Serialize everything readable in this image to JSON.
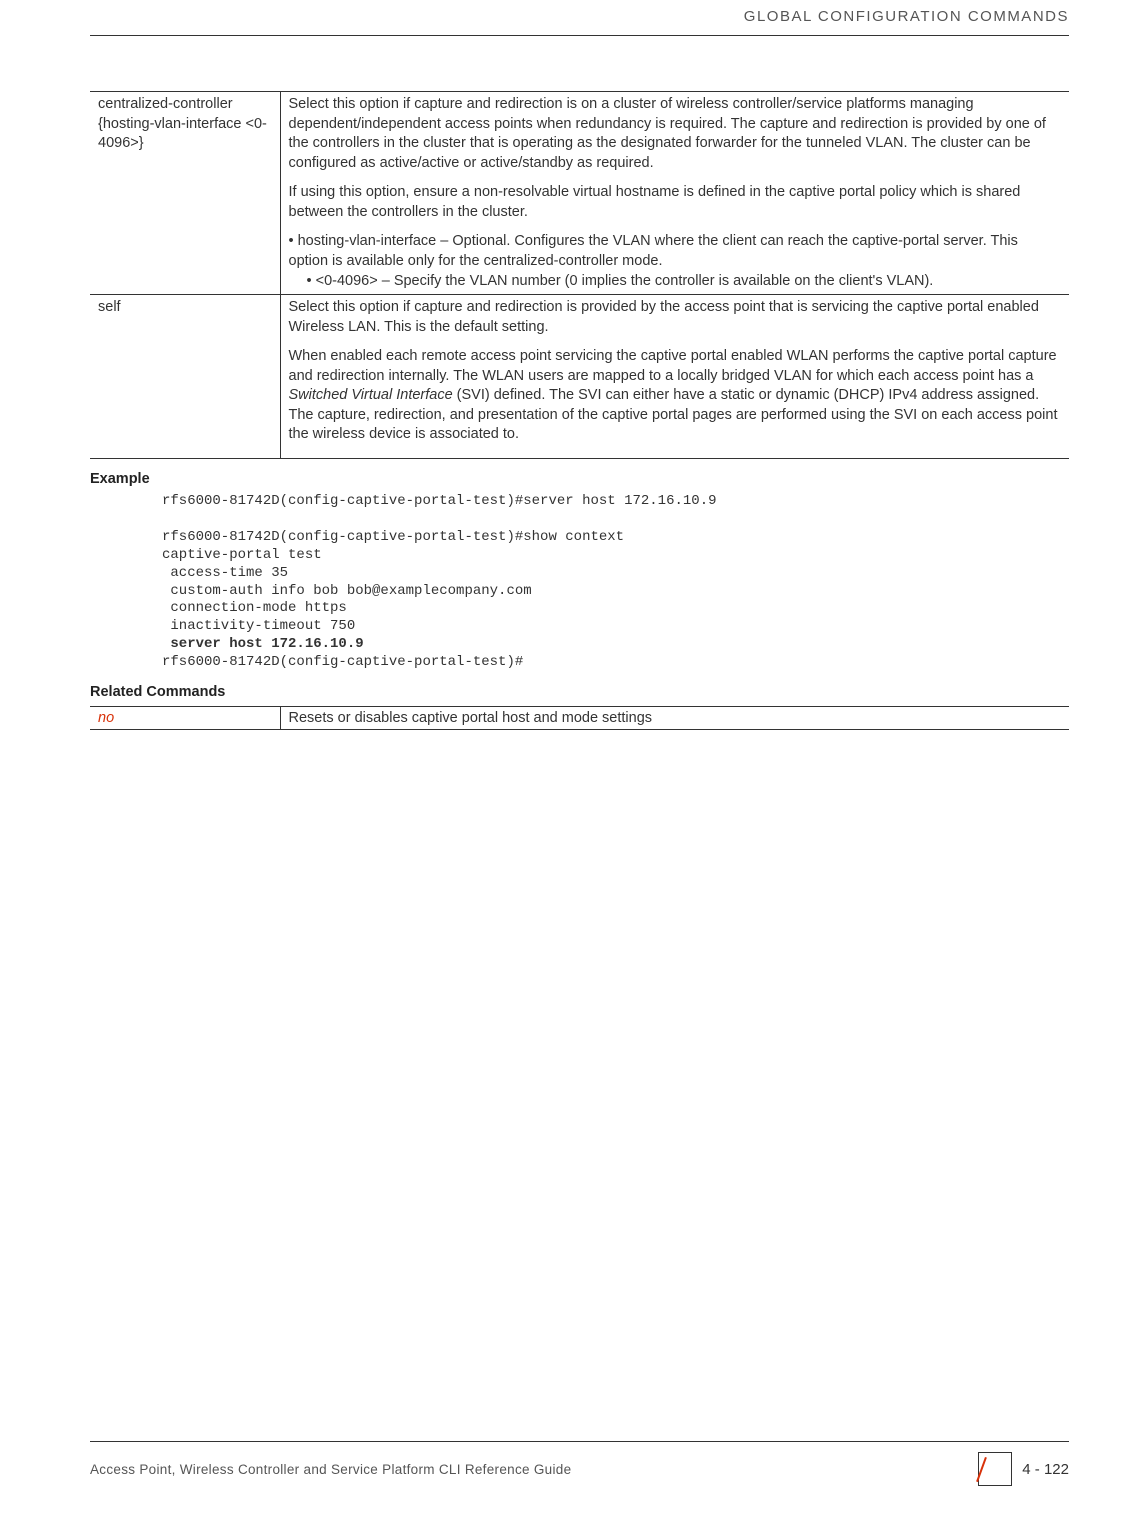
{
  "header": {
    "title": "GLOBAL CONFIGURATION COMMANDS"
  },
  "table1": {
    "row1": {
      "param": "centralized-controller {hosting-vlan-interface <0-4096>}",
      "p1": "Select this option if capture and redirection is on a cluster of wireless controller/service platforms managing dependent/independent access points when redundancy is required. The capture and redirection is provided by one of the controllers in the cluster that is operating as the designated forwarder for the tunneled VLAN. The cluster can be configured as active/active or active/standby as required.",
      "p2": "If using this option, ensure a non-resolvable virtual hostname is defined in the captive portal policy which is shared between the controllers in the cluster.",
      "b1": "hosting-vlan-interface – Optional. Configures the VLAN where the client can reach the captive-portal server. This option is available only for the centralized-controller mode.",
      "sb1": "<0-4096> – Specify the VLAN number (0 implies the controller is available on the client's VLAN)."
    },
    "row2": {
      "param": "self",
      "p1": "Select this option if capture and redirection is provided by the access point that is servicing the captive portal enabled Wireless LAN. This is the default setting.",
      "p2a": "When enabled each remote access point servicing the captive portal enabled WLAN performs the captive portal capture and redirection internally. The WLAN users are mapped to a locally bridged VLAN for which each access point has a ",
      "p2i": "Switched Virtual Interface",
      "p2b": " (SVI) defined. The SVI can either have a static or dynamic (DHCP) IPv4 address assigned. The capture, redirection, and presentation of the captive portal pages are performed using the SVI on each access point the wireless device is associated to."
    }
  },
  "example": {
    "heading": "Example",
    "line1": "rfs6000-81742D(config-captive-portal-test)#server host 172.16.10.9",
    "line2": "rfs6000-81742D(config-captive-portal-test)#show context",
    "line3": "captive-portal test",
    "line4": " access-time 35",
    "line5": " custom-auth info bob bob@examplecompany.com",
    "line6": " connection-mode https",
    "line7": " inactivity-timeout 750",
    "line8": " server host 172.16.10.9",
    "line9": "rfs6000-81742D(config-captive-portal-test)#"
  },
  "related": {
    "heading": "Related Commands",
    "cmd": "no",
    "desc": "Resets or disables captive portal host and mode settings"
  },
  "footer": {
    "left": "Access Point, Wireless Controller and Service Platform CLI Reference Guide",
    "page": "4 - 122"
  }
}
